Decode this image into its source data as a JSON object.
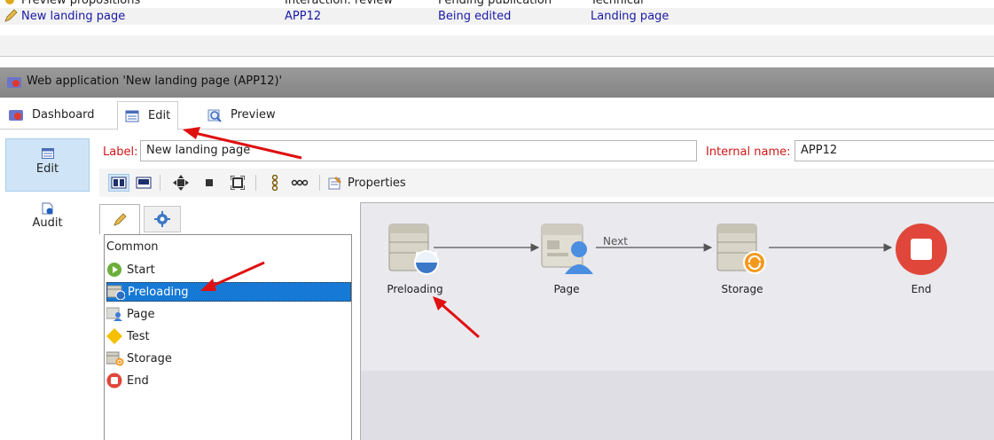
{
  "top_list": {
    "rows": [
      {
        "name": "Preview propositions",
        "status": "Interaction: review",
        "state": "Pending publication",
        "category": "Technical"
      },
      {
        "name": "New landing page",
        "status": "APP12",
        "state": "Being edited",
        "category": "Landing page"
      }
    ]
  },
  "window": {
    "title": "Web application 'New landing page (APP12)'"
  },
  "tabs": [
    {
      "label": "Dashboard",
      "icon": "dashboard-icon"
    },
    {
      "label": "Edit",
      "icon": "edit-icon",
      "active": true
    },
    {
      "label": "Preview",
      "icon": "magnifier-icon"
    }
  ],
  "leftnav": [
    {
      "label": "Edit",
      "icon": "edit-icon",
      "selected": true
    },
    {
      "label": "Audit",
      "icon": "audit-icon"
    }
  ],
  "form": {
    "label_caption": "Label:",
    "label_value": "New landing page",
    "internal_caption": "Internal name:",
    "internal_value": "APP12"
  },
  "toolbar": {
    "properties_label": "Properties"
  },
  "palette": {
    "header": "Common",
    "items": [
      {
        "label": "Start",
        "icon": "start-icon"
      },
      {
        "label": "Preloading",
        "icon": "preloading-icon",
        "selected": true
      },
      {
        "label": "Page",
        "icon": "page-icon"
      },
      {
        "label": "Test",
        "icon": "test-icon"
      },
      {
        "label": "Storage",
        "icon": "storage-icon"
      },
      {
        "label": "End",
        "icon": "end-icon"
      }
    ]
  },
  "workflow": {
    "nodes": [
      {
        "label": "Preloading",
        "icon": "preloading-node-icon"
      },
      {
        "label": "Page",
        "icon": "page-node-icon"
      },
      {
        "label": "Storage",
        "icon": "storage-node-icon"
      },
      {
        "label": "End",
        "icon": "end-node-icon"
      }
    ],
    "transition_label": "Next"
  },
  "colors": {
    "accent_red": "#d21616",
    "selection_blue": "#1679d6",
    "link_blue": "#1a1aa6",
    "annotation_red": "#e01010"
  }
}
